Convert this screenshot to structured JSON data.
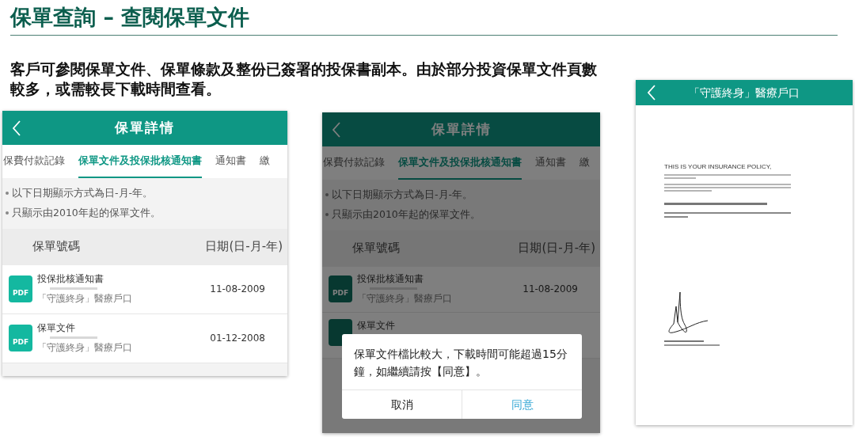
{
  "slide": {
    "title": "保單查詢 – 查閱保單文件",
    "description": "客戶可參閱保單文件、保單條款及整份已簽署的投保書副本。由於部分投資保單文件頁數較多，或需較長下載時間查看。"
  },
  "screens": [
    {
      "kind": "list",
      "dimmed": false,
      "header": "保單詳情",
      "tabs": [
        {
          "label": "保費付款記錄",
          "selected": false
        },
        {
          "label": "保單文件及投保批核通知書",
          "selected": true
        },
        {
          "label": "通知書",
          "selected": false
        },
        {
          "label": "繳",
          "selected": false
        }
      ],
      "notes": [
        "以下日期顯示方式為日-月-年。",
        "只顯示由2010年起的保單文件。"
      ],
      "columns": [
        "保單號碼",
        "日期(日-月-年)"
      ],
      "rows": [
        {
          "icon_label": "PDF",
          "title": "投保批核通知書",
          "subtitle": "「守護終身」醫療戶口",
          "date": "11-08-2009"
        },
        {
          "icon_label": "PDF",
          "title": "保單文件",
          "subtitle": "「守護終身」醫療戶口",
          "date": "01-12-2008"
        }
      ]
    },
    {
      "kind": "list",
      "dimmed": true,
      "header": "保單詳情",
      "tabs": [
        {
          "label": "保費付款記錄",
          "selected": false
        },
        {
          "label": "保單文件及投保批核通知書",
          "selected": true
        },
        {
          "label": "通知書",
          "selected": false
        },
        {
          "label": "繳",
          "selected": false
        }
      ],
      "notes": [
        "以下日期顯示方式為日-月-年。",
        "只顯示由2010年起的保單文件。"
      ],
      "columns": [
        "保單號碼",
        "日期(日-月-年)"
      ],
      "rows": [
        {
          "icon_label": "PDF",
          "title": "投保批核通知書",
          "subtitle": "「守護終身」醫療戶口",
          "date": "11-08-2009"
        },
        {
          "title": "保單文件"
        }
      ],
      "dialog": {
        "message": "保單文件檔比較大，下載時間可能超過15分鐘，如繼續請按【同意】。",
        "buttons": [
          {
            "label": "取消",
            "primary": false
          },
          {
            "label": "同意",
            "primary": true
          }
        ]
      }
    },
    {
      "kind": "document",
      "header": "「守護終身」醫療戶口",
      "heading": "THIS IS YOUR INSURANCE POLICY,"
    }
  ]
}
